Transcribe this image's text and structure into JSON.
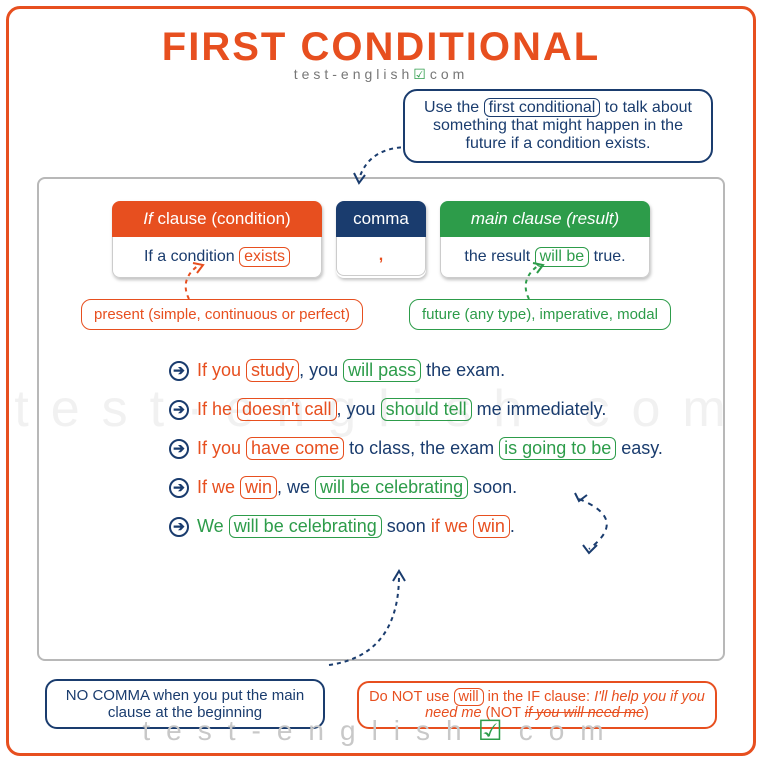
{
  "title": "FIRST CONDITIONAL",
  "site": "test-english",
  "site_suffix": "com",
  "intro": {
    "prefix": "Use the ",
    "boxed": "first conditional",
    "suffix": " to talk about something that might happen in the future if a condition exists."
  },
  "cards": {
    "if_header_i": "If",
    "if_header_r": " clause (condition)",
    "if_body_pre": "If a condition ",
    "if_body_pill": "exists",
    "comma_header": "comma",
    "comma_body": ",",
    "main_header": "main clause (result)",
    "main_body_pre": "the result ",
    "main_body_pill": "will be",
    "main_body_post": " true."
  },
  "tenses": {
    "orange": "present (simple, continuous or perfect)",
    "green": "future (any type), imperative, modal"
  },
  "examples": [
    {
      "parts": [
        {
          "t": "If you ",
          "c": "o"
        },
        {
          "pill": "study",
          "c": "o"
        },
        {
          "t": ", you ",
          "c": "n"
        },
        {
          "pill": "will pass",
          "c": "g"
        },
        {
          "t": " the exam.",
          "c": "n"
        }
      ]
    },
    {
      "parts": [
        {
          "t": "If he ",
          "c": "o"
        },
        {
          "pill": "doesn't call",
          "c": "o"
        },
        {
          "t": ", you ",
          "c": "n"
        },
        {
          "pill": "should tell",
          "c": "g"
        },
        {
          "t": " me immediately.",
          "c": "n"
        }
      ]
    },
    {
      "parts": [
        {
          "t": "If you ",
          "c": "o"
        },
        {
          "pill": "have come",
          "c": "o"
        },
        {
          "t": " to class, the exam ",
          "c": "n"
        },
        {
          "pill": "is going to be",
          "c": "g"
        },
        {
          "t": " easy.",
          "c": "n"
        }
      ]
    },
    {
      "parts": [
        {
          "t": "If we ",
          "c": "o"
        },
        {
          "pill": "win",
          "c": "o"
        },
        {
          "t": ", we ",
          "c": "n"
        },
        {
          "pill": "will be celebrating",
          "c": "g"
        },
        {
          "t": " soon.",
          "c": "n"
        }
      ]
    },
    {
      "parts": [
        {
          "t": "We ",
          "c": "g"
        },
        {
          "pill": "will be celebrating",
          "c": "g"
        },
        {
          "t": " soon ",
          "c": "n"
        },
        {
          "t": "if we ",
          "c": "o"
        },
        {
          "pill": "win",
          "c": "o"
        },
        {
          "t": ".",
          "c": "n"
        }
      ]
    }
  ],
  "no_comma": "NO COMMA when you put the main clause at the beginning",
  "no_will": {
    "p1": "Do NOT use ",
    "pill": "will",
    "p2": " in the IF clause: ",
    "italic": "I'll help you if you need me",
    "p3": " (NOT ",
    "strike": "if you will need me",
    "p4": ")"
  },
  "footer": "test-english",
  "footer_suffix": "com"
}
